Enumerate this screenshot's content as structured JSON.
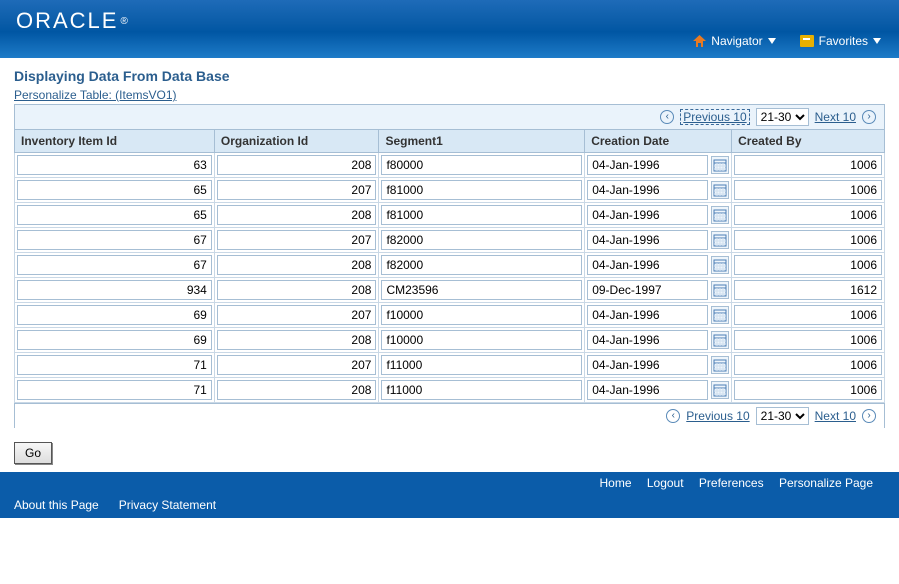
{
  "header": {
    "brand": "ORACLE",
    "navigator_label": "Navigator",
    "favorites_label": "Favorites"
  },
  "page": {
    "title": "Displaying Data From Data Base",
    "personalize_link": "Personalize Table: (ItemsVO1)",
    "go_label": "Go"
  },
  "pagination": {
    "prev_label": "Previous 10",
    "next_label": "Next 10",
    "range": "21-30"
  },
  "table": {
    "headers": {
      "c0": "Inventory Item Id",
      "c1": "Organization Id",
      "c2": "Segment1",
      "c3": "Creation Date",
      "c4": "Created By"
    },
    "rows": [
      {
        "item": "63",
        "org": "208",
        "seg": "f80000",
        "date": "04-Jan-1996",
        "by": "1006"
      },
      {
        "item": "65",
        "org": "207",
        "seg": "f81000",
        "date": "04-Jan-1996",
        "by": "1006"
      },
      {
        "item": "65",
        "org": "208",
        "seg": "f81000",
        "date": "04-Jan-1996",
        "by": "1006"
      },
      {
        "item": "67",
        "org": "207",
        "seg": "f82000",
        "date": "04-Jan-1996",
        "by": "1006"
      },
      {
        "item": "67",
        "org": "208",
        "seg": "f82000",
        "date": "04-Jan-1996",
        "by": "1006"
      },
      {
        "item": "934",
        "org": "208",
        "seg": "CM23596",
        "date": "09-Dec-1997",
        "by": "1612"
      },
      {
        "item": "69",
        "org": "207",
        "seg": "f10000",
        "date": "04-Jan-1996",
        "by": "1006"
      },
      {
        "item": "69",
        "org": "208",
        "seg": "f10000",
        "date": "04-Jan-1996",
        "by": "1006"
      },
      {
        "item": "71",
        "org": "207",
        "seg": "f11000",
        "date": "04-Jan-1996",
        "by": "1006"
      },
      {
        "item": "71",
        "org": "208",
        "seg": "f11000",
        "date": "04-Jan-1996",
        "by": "1006"
      }
    ]
  },
  "footer": {
    "home": "Home",
    "logout": "Logout",
    "prefs": "Preferences",
    "personalize": "Personalize Page",
    "about": "About this Page",
    "privacy": "Privacy Statement"
  }
}
